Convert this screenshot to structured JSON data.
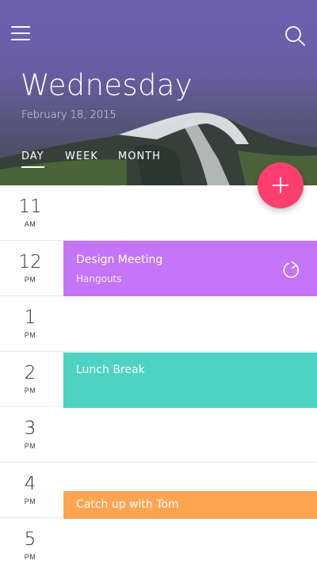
{
  "header": {
    "day": "Wednesday",
    "date": "February 18, 2015",
    "tabs": [
      {
        "label": "DAY",
        "active": true
      },
      {
        "label": "WEEK",
        "active": false
      },
      {
        "label": "MONTH",
        "active": false
      }
    ],
    "icons": {
      "menu": "menu-icon",
      "search": "search-icon",
      "add": "plus-icon"
    }
  },
  "timeline": {
    "hours": [
      {
        "hour": "11",
        "period": "AM"
      },
      {
        "hour": "12",
        "period": "PM"
      },
      {
        "hour": "1",
        "period": "PM"
      },
      {
        "hour": "2",
        "period": "PM"
      },
      {
        "hour": "3",
        "period": "PM"
      },
      {
        "hour": "4",
        "period": "PM"
      },
      {
        "hour": "5",
        "period": "PM"
      }
    ]
  },
  "events": [
    {
      "title": "Design Meeting",
      "subtitle": "Hangouts",
      "color": "#c474f7",
      "icon": "repeat-icon"
    },
    {
      "title": "Lunch Break",
      "color": "#4ed3c2"
    },
    {
      "title": "Catch up with Tom",
      "color": "#ffa450"
    }
  ],
  "colors": {
    "accent": "#fd3f6f",
    "header": "#6c5fae"
  }
}
